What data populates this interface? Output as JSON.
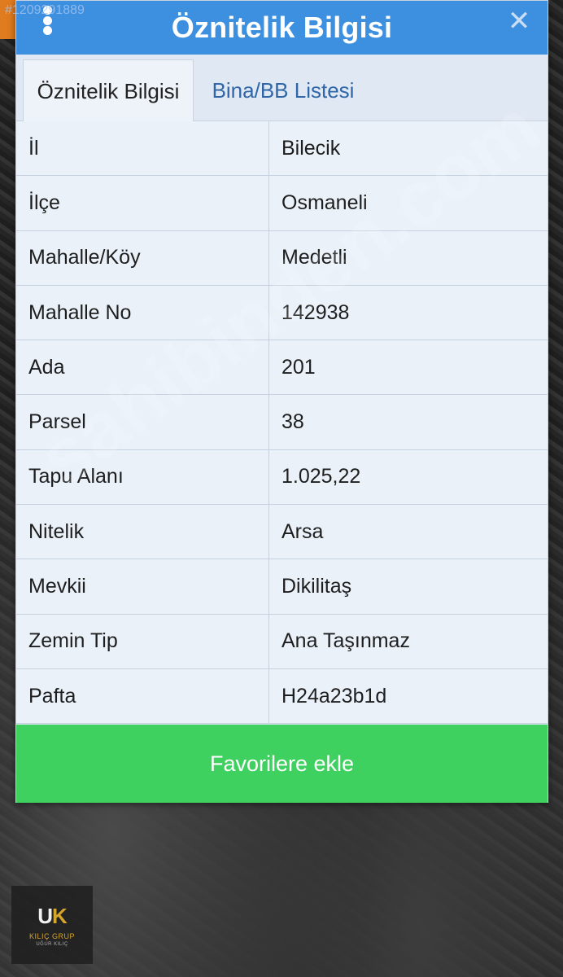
{
  "listing_id": "#1209291889",
  "dialog": {
    "title": "Öznitelik Bilgisi",
    "tabs": [
      {
        "label": "Öznitelik Bilgisi",
        "active": true
      },
      {
        "label": "Bina/BB Listesi",
        "active": false
      }
    ],
    "rows": [
      {
        "key": "İl",
        "value": "Bilecik"
      },
      {
        "key": "İlçe",
        "value": "Osmaneli"
      },
      {
        "key": "Mahalle/Köy",
        "value": "Medetli"
      },
      {
        "key": "Mahalle No",
        "value": "142938"
      },
      {
        "key": "Ada",
        "value": "201"
      },
      {
        "key": "Parsel",
        "value": "38"
      },
      {
        "key": "Tapu Alanı",
        "value": "1.025,22"
      },
      {
        "key": "Nitelik",
        "value": "Arsa"
      },
      {
        "key": "Mevkii",
        "value": "Dikilitaş"
      },
      {
        "key": "Zemin Tip",
        "value": "Ana Taşınmaz"
      },
      {
        "key": "Pafta",
        "value": "H24a23b1d"
      }
    ],
    "button_label": "Favorilere ekle"
  },
  "watermark": "sahibinden.com",
  "logo": {
    "mark_u": "U",
    "mark_k": "K",
    "name": "KILIÇ GRUP",
    "sub": "UĞUR KILIÇ"
  },
  "colors": {
    "titlebar": "#3d8fe0",
    "button": "#3fd160",
    "tab_link": "#2f66a8"
  }
}
